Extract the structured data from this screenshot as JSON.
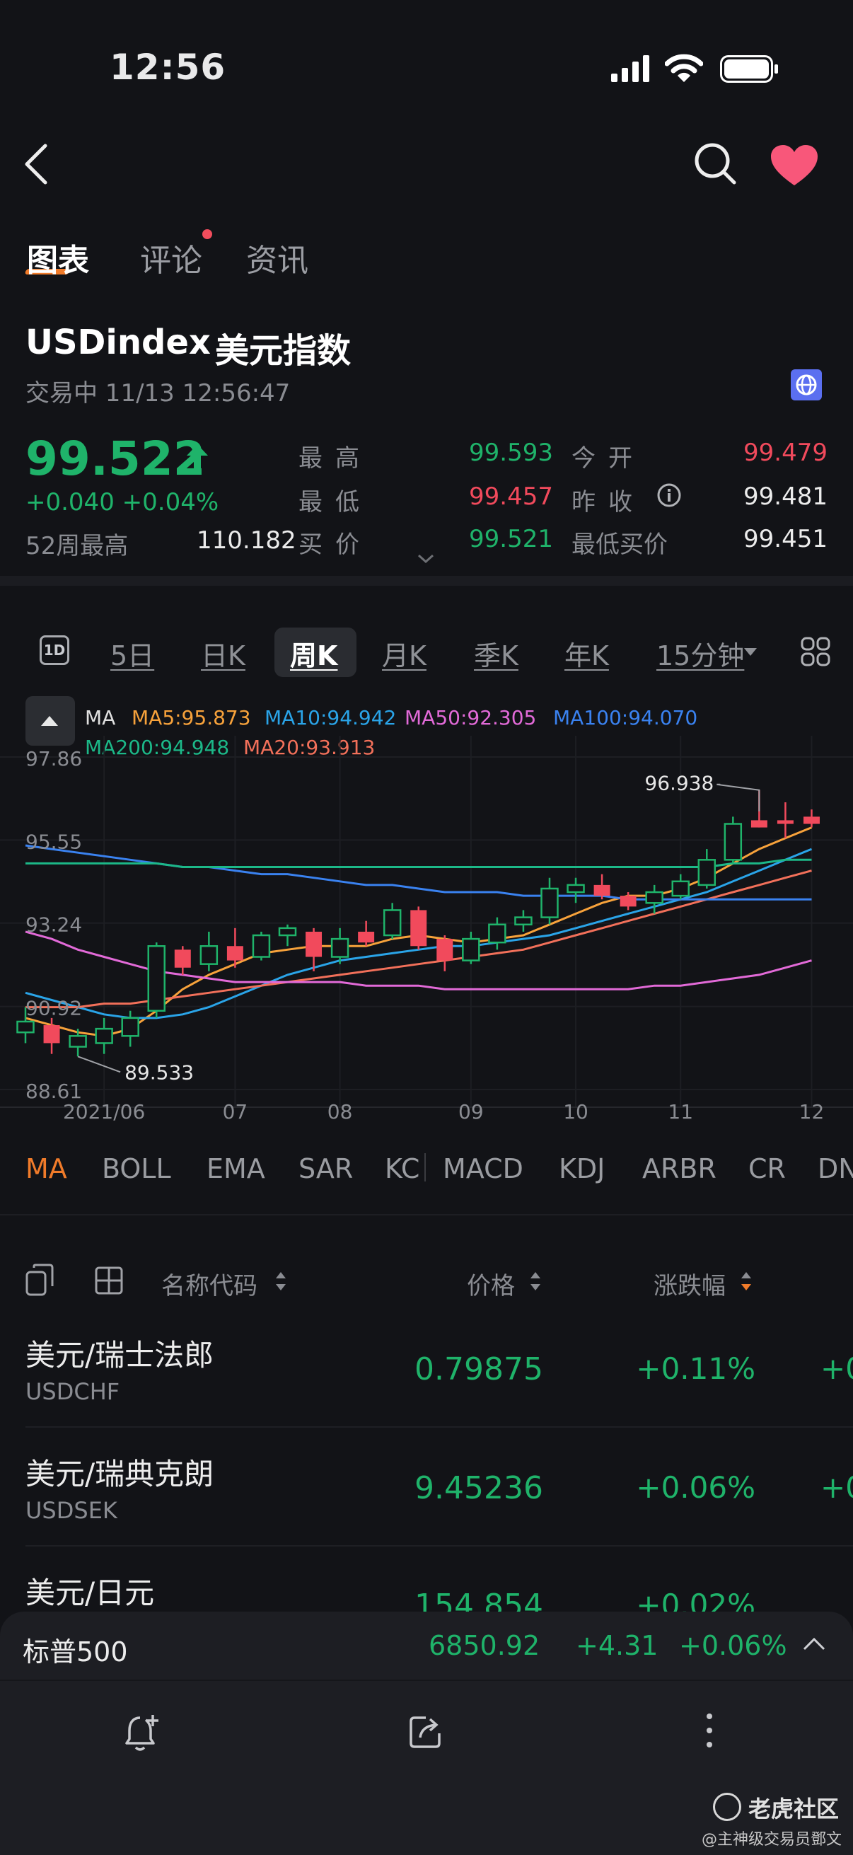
{
  "status_bar": {
    "time": "12:56"
  },
  "tabs": [
    {
      "label": "图表",
      "active": true
    },
    {
      "label": "评论",
      "has_dot": true
    },
    {
      "label": "资讯"
    }
  ],
  "instrument": {
    "symbol": "USDindex",
    "name": "美元指数",
    "status": "交易中 11/13 12:56:47",
    "price": "99.522",
    "change": "+0.040",
    "change_pct": "+0.04%",
    "week52_high_label": "52周最高",
    "week52_high": "110.182"
  },
  "quote": {
    "high_label": "最高",
    "high": "99.593",
    "open_label": "今开",
    "open": "99.479",
    "low_label": "最低",
    "low": "99.457",
    "prev_close_label": "昨收",
    "prev_close": "99.481",
    "bid_label": "买价",
    "bid": "99.521",
    "lowest_bid_label": "最低买价",
    "lowest_bid": "99.451"
  },
  "periods": [
    "5日",
    "日K",
    "周K",
    "月K",
    "季K",
    "年K",
    "15分钟"
  ],
  "period_1d_label": "1D",
  "active_period": "周K",
  "ma_legend": {
    "title": "MA",
    "ma5": "MA5:95.873",
    "ma10": "MA10:94.942",
    "ma50": "MA50:92.305",
    "ma100": "MA100:94.070",
    "ma200": "MA200:94.948",
    "ma20": "MA20:93.913"
  },
  "colors": {
    "up": "#1fb36a",
    "down": "#f14a5c",
    "accent": "#f07b2a",
    "ma5": "#f7a23b",
    "ma10": "#2aa4e8",
    "ma20": "#f2705a",
    "ma50": "#e26ad8",
    "ma100": "#3a82f0",
    "ma200": "#1cb888"
  },
  "chart_data": {
    "type": "candlestick",
    "y_ticks": [
      "97.86",
      "95.55",
      "93.24",
      "90.92",
      "88.61"
    ],
    "ylim": [
      88.61,
      97.86
    ],
    "x_ticks": [
      "2021/06",
      "07",
      "08",
      "09",
      "10",
      "11",
      "12"
    ],
    "annotations": {
      "max": "96.938",
      "min": "89.533"
    },
    "candles": [
      {
        "o": 90.2,
        "h": 90.9,
        "l": 89.9,
        "c": 90.5
      },
      {
        "o": 90.4,
        "h": 90.6,
        "l": 89.6,
        "c": 89.9
      },
      {
        "o": 89.8,
        "h": 90.3,
        "l": 89.53,
        "c": 90.1
      },
      {
        "o": 89.9,
        "h": 90.6,
        "l": 89.6,
        "c": 90.3
      },
      {
        "o": 90.1,
        "h": 90.8,
        "l": 89.8,
        "c": 90.6
      },
      {
        "o": 90.8,
        "h": 92.7,
        "l": 90.6,
        "c": 92.6
      },
      {
        "o": 92.5,
        "h": 92.6,
        "l": 91.8,
        "c": 92.0
      },
      {
        "o": 92.1,
        "h": 93.0,
        "l": 91.9,
        "c": 92.6
      },
      {
        "o": 92.6,
        "h": 93.1,
        "l": 92.0,
        "c": 92.2
      },
      {
        "o": 92.3,
        "h": 93.0,
        "l": 92.2,
        "c": 92.9
      },
      {
        "o": 92.9,
        "h": 93.2,
        "l": 92.6,
        "c": 93.1
      },
      {
        "o": 93.0,
        "h": 93.1,
        "l": 91.9,
        "c": 92.3
      },
      {
        "o": 92.3,
        "h": 93.1,
        "l": 92.1,
        "c": 92.8
      },
      {
        "o": 93.0,
        "h": 93.3,
        "l": 92.6,
        "c": 92.7
      },
      {
        "o": 92.9,
        "h": 93.8,
        "l": 92.8,
        "c": 93.6
      },
      {
        "o": 93.6,
        "h": 93.7,
        "l": 92.5,
        "c": 92.6
      },
      {
        "o": 92.8,
        "h": 92.9,
        "l": 91.9,
        "c": 92.2
      },
      {
        "o": 92.2,
        "h": 93.0,
        "l": 92.1,
        "c": 92.8
      },
      {
        "o": 92.7,
        "h": 93.4,
        "l": 92.5,
        "c": 93.2
      },
      {
        "o": 93.2,
        "h": 93.6,
        "l": 93.0,
        "c": 93.4
      },
      {
        "o": 93.4,
        "h": 94.5,
        "l": 93.2,
        "c": 94.2
      },
      {
        "o": 94.1,
        "h": 94.5,
        "l": 93.8,
        "c": 94.3
      },
      {
        "o": 94.3,
        "h": 94.6,
        "l": 93.9,
        "c": 94.0
      },
      {
        "o": 94.0,
        "h": 94.1,
        "l": 93.6,
        "c": 93.7
      },
      {
        "o": 93.8,
        "h": 94.3,
        "l": 93.5,
        "c": 94.1
      },
      {
        "o": 94.0,
        "h": 94.6,
        "l": 93.9,
        "c": 94.4
      },
      {
        "o": 94.3,
        "h": 95.3,
        "l": 94.2,
        "c": 95.0
      },
      {
        "o": 95.0,
        "h": 96.2,
        "l": 94.9,
        "c": 96.0
      },
      {
        "o": 96.1,
        "h": 96.94,
        "l": 95.9,
        "c": 95.9
      },
      {
        "o": 96.1,
        "h": 96.6,
        "l": 95.6,
        "c": 96.0
      },
      {
        "o": 96.2,
        "h": 96.4,
        "l": 95.9,
        "c": 96.0
      }
    ],
    "ma_lines": {
      "ma5": [
        90.6,
        90.4,
        90.2,
        90.1,
        90.3,
        90.8,
        91.4,
        91.8,
        92.1,
        92.4,
        92.5,
        92.6,
        92.6,
        92.6,
        92.8,
        92.9,
        92.8,
        92.7,
        92.8,
        92.9,
        93.2,
        93.5,
        93.8,
        94.0,
        94.0,
        94.2,
        94.5,
        94.9,
        95.3,
        95.6,
        95.9
      ],
      "ma10": [
        91.3,
        91.1,
        90.9,
        90.7,
        90.6,
        90.6,
        90.7,
        90.9,
        91.2,
        91.5,
        91.8,
        92.0,
        92.2,
        92.3,
        92.4,
        92.5,
        92.6,
        92.6,
        92.7,
        92.8,
        92.9,
        93.1,
        93.3,
        93.5,
        93.7,
        93.9,
        94.1,
        94.4,
        94.7,
        95.0,
        95.3
      ],
      "ma20": [
        90.9,
        90.9,
        90.9,
        91.0,
        91.0,
        91.1,
        91.2,
        91.3,
        91.4,
        91.5,
        91.6,
        91.7,
        91.8,
        91.9,
        92.0,
        92.1,
        92.2,
        92.3,
        92.4,
        92.5,
        92.7,
        92.9,
        93.1,
        93.3,
        93.5,
        93.7,
        93.9,
        94.1,
        94.3,
        94.5,
        94.7
      ],
      "ma50": [
        93.0,
        92.8,
        92.5,
        92.3,
        92.1,
        91.9,
        91.8,
        91.7,
        91.6,
        91.6,
        91.6,
        91.6,
        91.6,
        91.5,
        91.5,
        91.5,
        91.4,
        91.4,
        91.4,
        91.4,
        91.4,
        91.4,
        91.4,
        91.4,
        91.5,
        91.5,
        91.6,
        91.7,
        91.8,
        92.0,
        92.2
      ],
      "ma100": [
        95.4,
        95.3,
        95.2,
        95.1,
        95.0,
        94.9,
        94.8,
        94.8,
        94.7,
        94.6,
        94.6,
        94.5,
        94.4,
        94.3,
        94.3,
        94.2,
        94.1,
        94.1,
        94.1,
        94.0,
        94.0,
        94.0,
        94.0,
        93.9,
        93.9,
        93.9,
        93.9,
        93.9,
        93.9,
        93.9,
        93.9
      ],
      "ma200": [
        94.9,
        94.9,
        94.9,
        94.9,
        94.9,
        94.9,
        94.8,
        94.8,
        94.8,
        94.8,
        94.8,
        94.8,
        94.8,
        94.8,
        94.8,
        94.8,
        94.8,
        94.8,
        94.8,
        94.8,
        94.8,
        94.8,
        94.8,
        94.8,
        94.8,
        94.8,
        94.8,
        94.9,
        94.9,
        95.0,
        95.0
      ]
    }
  },
  "indicators": [
    "MA",
    "BOLL",
    "EMA",
    "SAR",
    "KC",
    "MACD",
    "KDJ",
    "ARBR",
    "CR",
    "DN"
  ],
  "table": {
    "headers": {
      "name": "名称代码",
      "price": "价格",
      "change": "涨跌幅"
    },
    "rows": [
      {
        "name": "美元/瑞士法郎",
        "code": "USDCHF",
        "price": "0.79875",
        "pct": "+0.11%",
        "extra": "+0"
      },
      {
        "name": "美元/瑞典克朗",
        "code": "USDSEK",
        "price": "9.45236",
        "pct": "+0.06%",
        "extra": "+0"
      },
      {
        "name": "美元/日元",
        "code": "",
        "price": "154.854",
        "pct": "+0.02%",
        "extra": ""
      }
    ]
  },
  "ticker": {
    "name": "标普500",
    "price": "6850.92",
    "change": "+4.31",
    "pct": "+0.06%"
  },
  "watermark": {
    "brand": "老虎社区",
    "author": "@主神级交易员鄧文"
  }
}
